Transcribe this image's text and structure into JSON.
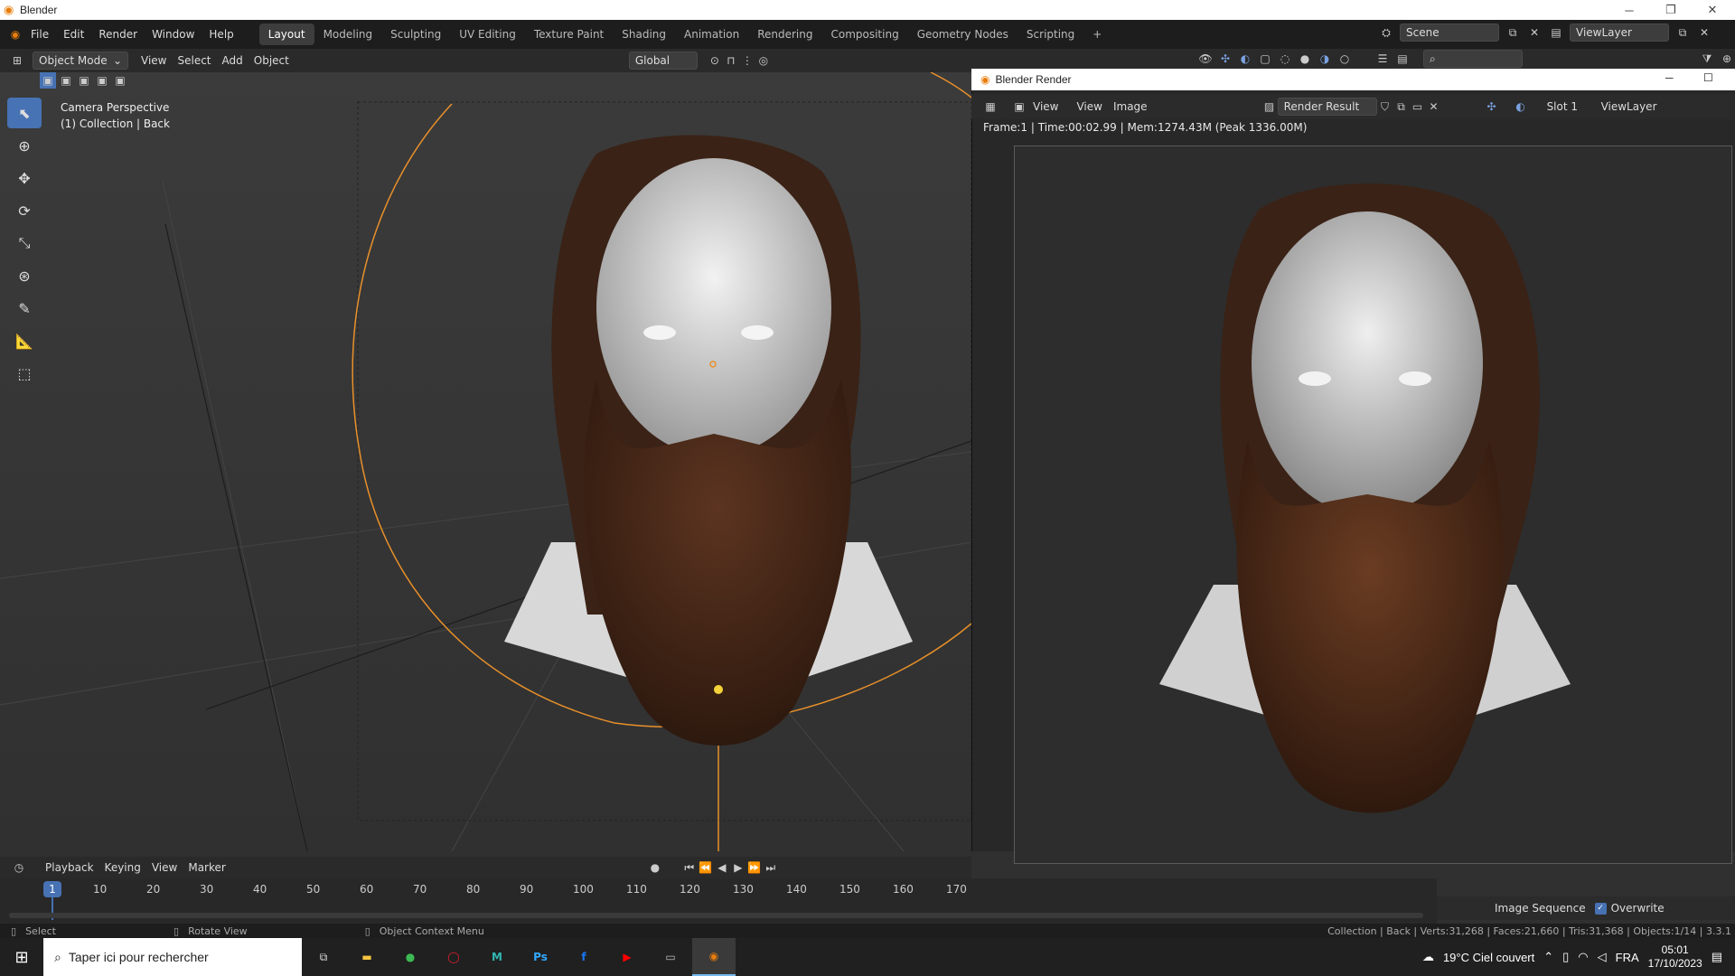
{
  "window": {
    "title": "Blender"
  },
  "menu": {
    "items": [
      "File",
      "Edit",
      "Render",
      "Window",
      "Help"
    ]
  },
  "workspaces": {
    "tabs": [
      "Layout",
      "Modeling",
      "Sculpting",
      "UV Editing",
      "Texture Paint",
      "Shading",
      "Animation",
      "Rendering",
      "Compositing",
      "Geometry Nodes",
      "Scripting"
    ],
    "active": "Layout",
    "add": "+"
  },
  "scene": {
    "name": "Scene",
    "viewlayer": "ViewLayer"
  },
  "header3d": {
    "mode": "Object Mode",
    "view": "View",
    "select": "Select",
    "add": "Add",
    "object": "Object",
    "orientation": "Global"
  },
  "viewport": {
    "camera_label": "Camera Perspective",
    "collection_label": "(1) Collection | Back"
  },
  "render_window": {
    "title": "Blender Render",
    "view_menu": "View",
    "view": "View",
    "image": "Image",
    "result": "Render Result",
    "slot": "Slot 1",
    "viewlayer": "ViewLayer",
    "info": "Frame:1 | Time:00:02.99 | Mem:1274.43M (Peak 1336.00M)"
  },
  "timeline": {
    "playback": "Playback",
    "keying": "Keying",
    "view": "View",
    "marker": "Marker",
    "current_frame": "1",
    "ticks": [
      "10",
      "20",
      "30",
      "40",
      "50",
      "60",
      "70",
      "80",
      "90",
      "100",
      "110",
      "120",
      "130",
      "140",
      "150",
      "160",
      "170"
    ]
  },
  "image_sequence": {
    "label": "Image Sequence",
    "overwrite": "Overwrite"
  },
  "statusbar": {
    "select": "Select",
    "rotate": "Rotate View",
    "context": "Object Context Menu",
    "stats": "Collection | Back | Verts:31,268 | Faces:21,660 | Tris:31,368 | Objects:1/14 | 3.3.1"
  },
  "taskbar": {
    "search": "Taper ici pour rechercher",
    "weather": "19°C  Ciel couvert",
    "lang": "FRA",
    "time": "05:01",
    "date": "17/10/2023"
  },
  "colors": {
    "accent": "#4772b3",
    "camera": "#e8902a",
    "beard": "#4a2a18"
  }
}
